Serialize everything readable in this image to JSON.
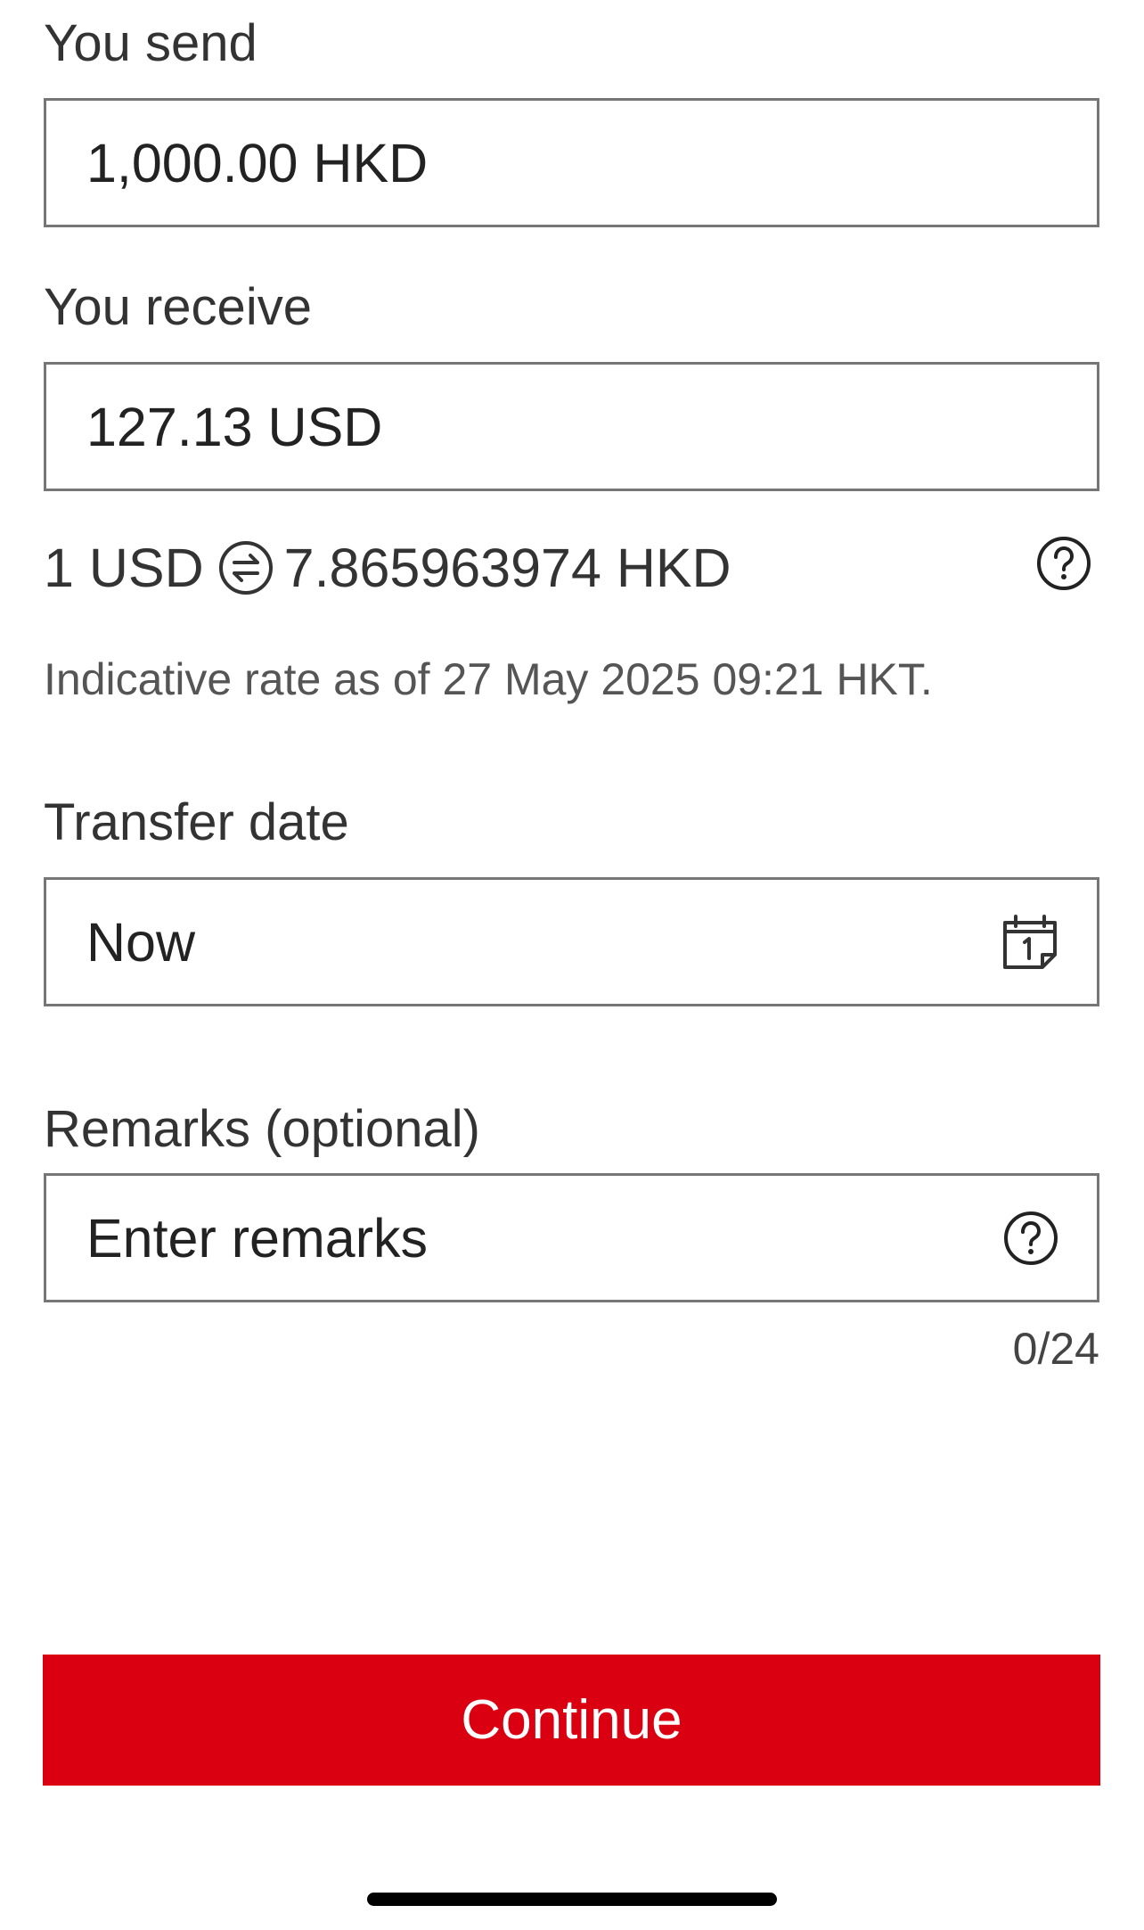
{
  "send": {
    "label": "You send",
    "value": "1,000.00 HKD"
  },
  "receive": {
    "label": "You receive",
    "value": "127.13 USD"
  },
  "rate": {
    "left": "1 USD",
    "right": "7.865963974 HKD",
    "swap_icon": "swap-arrows-icon",
    "help_icon": "question-circle-icon",
    "indicative_text": "Indicative rate as of 27 May 2025 09:21 HKT."
  },
  "transfer_date": {
    "label": "Transfer date",
    "value": "Now",
    "icon": "calendar-icon"
  },
  "remarks": {
    "label": "Remarks (optional)",
    "placeholder": "Enter remarks",
    "icon": "question-circle-icon",
    "counter": "0/24"
  },
  "actions": {
    "continue_label": "Continue"
  },
  "colors": {
    "brand_red": "#db0011",
    "border_gray": "#767676",
    "text_dark": "#333333"
  }
}
